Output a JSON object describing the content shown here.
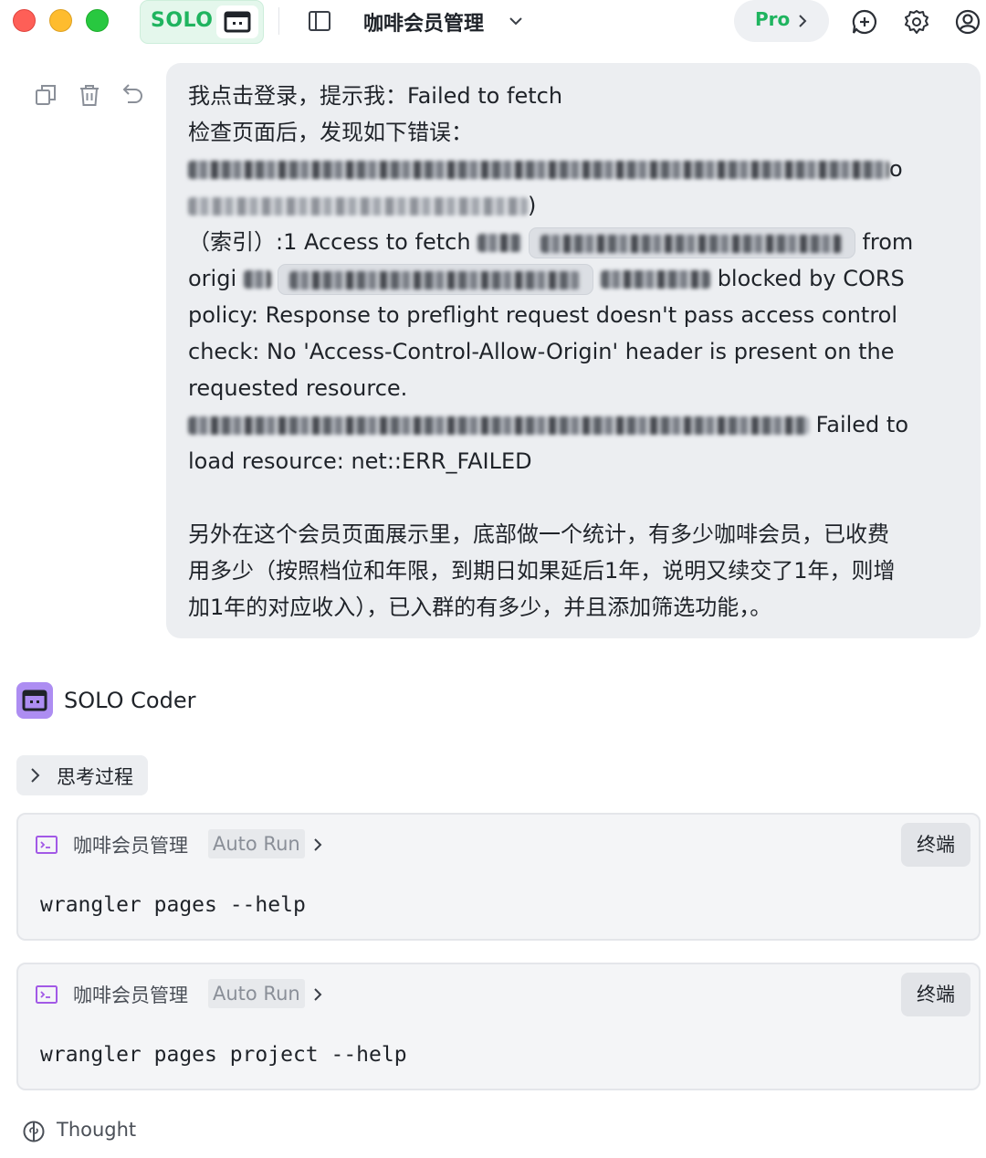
{
  "titlebar": {
    "solo_label": "SOLO",
    "project_title": "咖啡会员管理",
    "pro_label": "Pro",
    "icons": [
      "solo-agent-icon",
      "sidebar-toggle-icon",
      "chevron-down-icon",
      "chevron-right-icon",
      "new-chat-icon",
      "gear-icon",
      "user-icon"
    ]
  },
  "user_message": {
    "tools": [
      "copy-icon",
      "trash-icon",
      "undo-icon"
    ],
    "line1": "我点击登录，提示我：Failed to fetch",
    "line2": "检查页面后，发现如下错误：",
    "line3_tail": "o",
    "line4_tail": ")",
    "line5_a": "（索引）:1 Access to fetch",
    "line5_b": "from",
    "line6_a": "origi",
    "line6_b": "blocked by CORS",
    "line7": "policy: Response to preflight request doesn't pass access control",
    "line8": "check: No 'Access-Control-Allow-Origin' header is present on the",
    "line9": "requested resource.",
    "line10_b": "Failed to",
    "line11": "load resource: net::ERR_FAILED",
    "line12": "另外在这个会员页面展示里，底部做一个统计，有多少咖啡会员，已收费",
    "line13": "用多少（按照档位和年限，到期日如果延后1年，说明又续交了1年，则增",
    "line14": "加1年的对应收入），已入群的有多少，并且添加筛选功能，。"
  },
  "assistant": {
    "name": "SOLO Coder",
    "thinking_label": "思考过程",
    "commands": [
      {
        "project": "咖啡会员管理",
        "badge": "Auto Run",
        "terminal_label": "终端",
        "code": "wrangler pages --help"
      },
      {
        "project": "咖啡会员管理",
        "badge": "Auto Run",
        "terminal_label": "终端",
        "code": "wrangler pages project --help"
      }
    ],
    "thought_label": "Thought"
  },
  "colors": {
    "accent_green": "#1fb45f",
    "bubble_bg": "#eceef1",
    "avatar_purple": "#ad8df2",
    "terminal_icon_purple": "#a259e6"
  }
}
